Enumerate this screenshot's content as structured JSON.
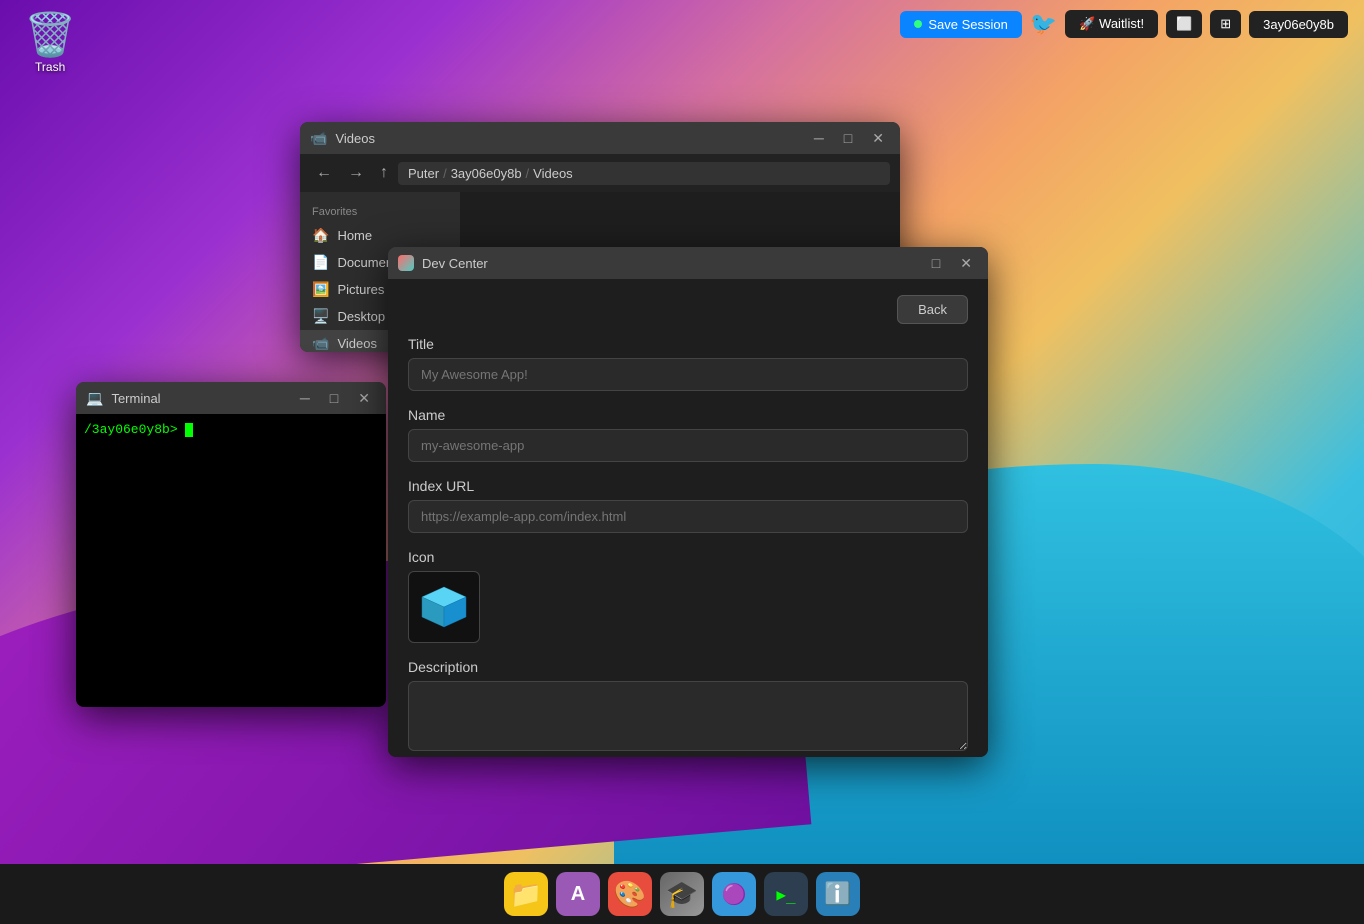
{
  "desktop": {
    "trash_label": "Trash"
  },
  "topbar": {
    "save_session_label": "Save Session",
    "waitlist_label": "🚀 Waitlist!",
    "user_label": "3ay06e0y8b"
  },
  "videos_window": {
    "title": "Videos",
    "breadcrumb": [
      "Puter",
      "3ay06e0y8b",
      "Videos"
    ],
    "sidebar": {
      "section_label": "Favorites",
      "items": [
        {
          "label": "Home",
          "icon": "🏠"
        },
        {
          "label": "Documents",
          "icon": "📄"
        },
        {
          "label": "Pictures",
          "icon": "🖼️"
        },
        {
          "label": "Desktop",
          "icon": "🖥️"
        },
        {
          "label": "Videos",
          "icon": "📹"
        }
      ]
    }
  },
  "terminal_window": {
    "title": "Terminal",
    "prompt": "/3ay06e0y8b> "
  },
  "devcenter_window": {
    "title": "Dev Center",
    "back_button": "Back",
    "fields": {
      "title_label": "Title",
      "title_placeholder": "My Awesome App!",
      "name_label": "Name",
      "name_placeholder": "my-awesome-app",
      "index_url_label": "Index URL",
      "index_url_placeholder": "https://example-app.com/index.html",
      "icon_label": "Icon",
      "description_label": "Description"
    }
  },
  "taskbar": {
    "icons": [
      {
        "name": "folder",
        "symbol": "📁"
      },
      {
        "name": "font",
        "symbol": "A"
      },
      {
        "name": "paint",
        "symbol": "🎨"
      },
      {
        "name": "graduate",
        "symbol": "🎓"
      },
      {
        "name": "apps",
        "symbol": "🟣"
      },
      {
        "name": "terminal",
        "symbol": ">_"
      },
      {
        "name": "info",
        "symbol": "ℹ️"
      }
    ]
  }
}
